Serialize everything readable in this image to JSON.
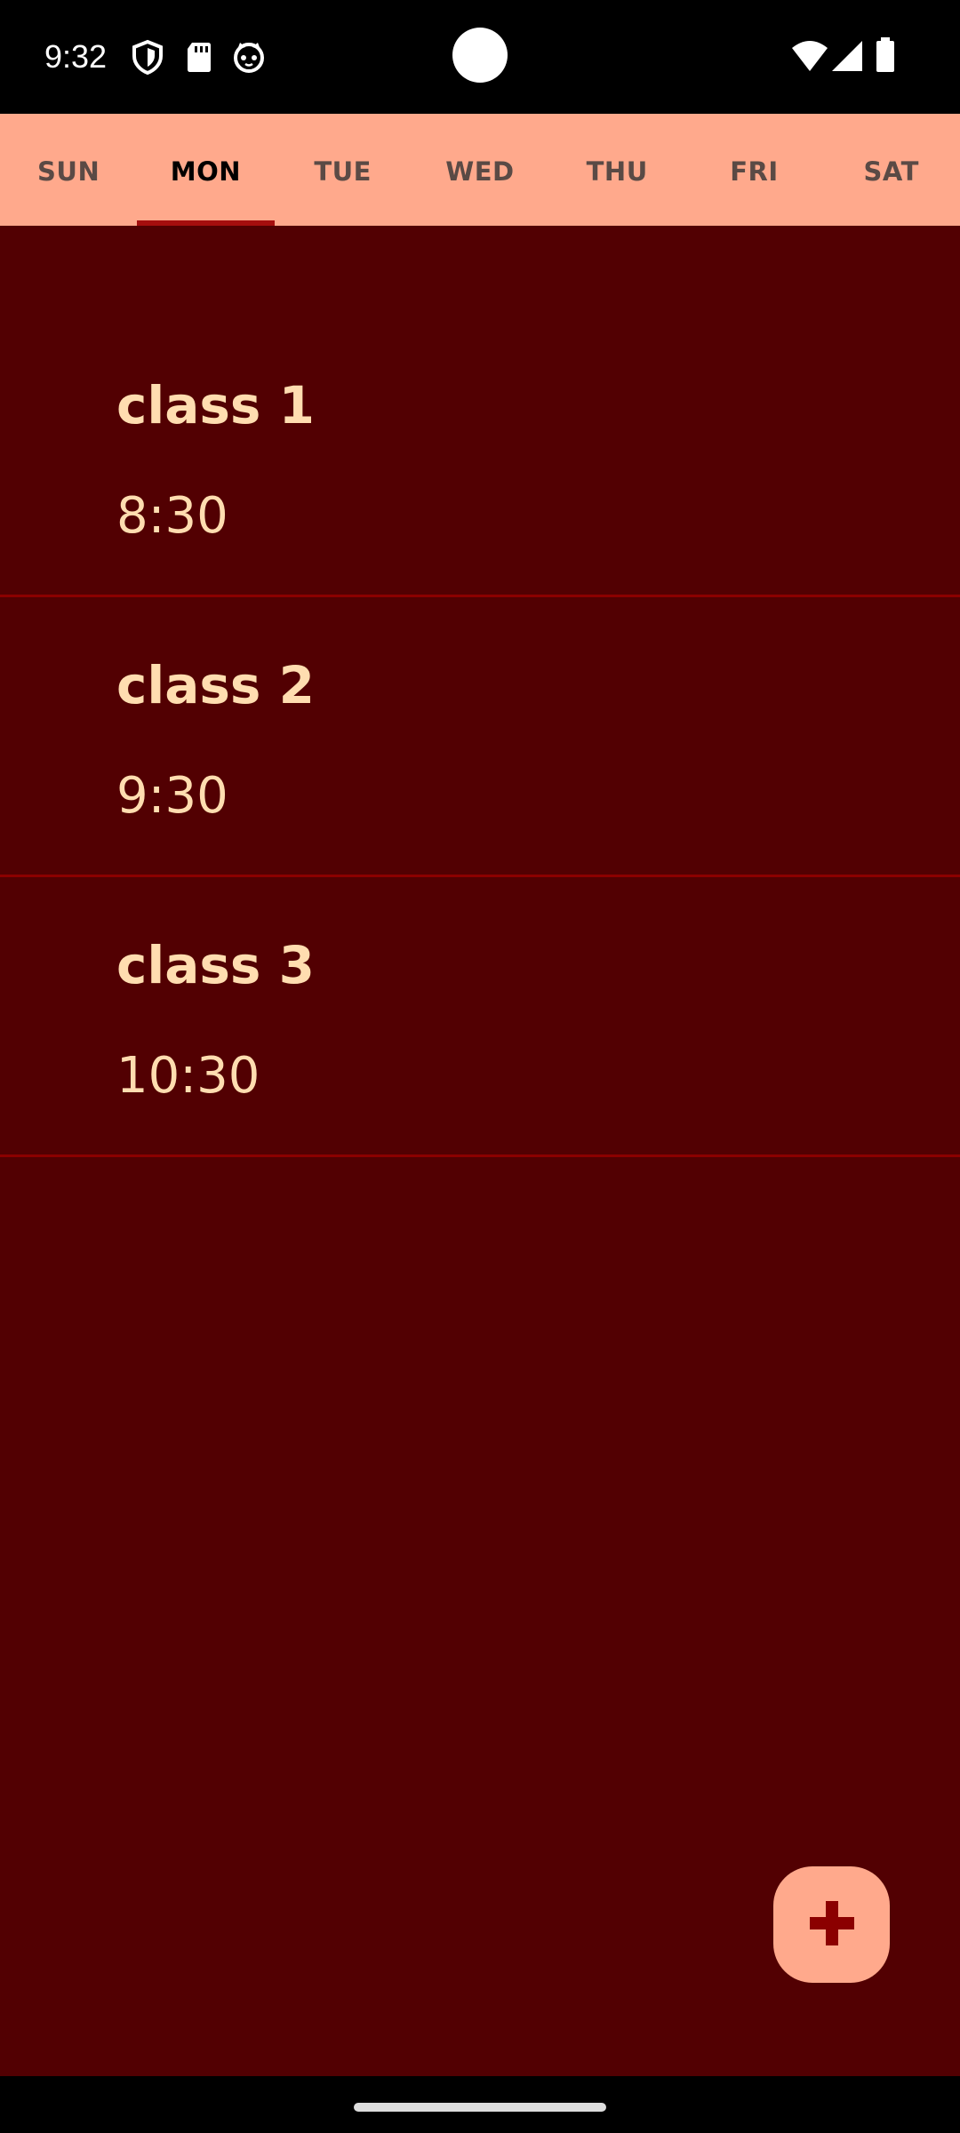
{
  "status_bar": {
    "time": "9:32",
    "icons_left": [
      "shield-icon",
      "sd-card-icon",
      "cat-face-icon"
    ],
    "icons_right": [
      "wifi-icon",
      "cellular-signal-icon",
      "battery-icon"
    ]
  },
  "tabs": [
    {
      "label": "SUN",
      "active": false
    },
    {
      "label": "MON",
      "active": true
    },
    {
      "label": "TUE",
      "active": false
    },
    {
      "label": "WED",
      "active": false
    },
    {
      "label": "THU",
      "active": false
    },
    {
      "label": "FRI",
      "active": false
    },
    {
      "label": "SAT",
      "active": false
    }
  ],
  "classes": [
    {
      "name": "class 1",
      "time": "8:30"
    },
    {
      "name": "class 2",
      "time": "9:30"
    },
    {
      "name": "class 3",
      "time": "10:30"
    }
  ],
  "fab": {
    "icon": "plus-icon"
  },
  "colors": {
    "tab_bar": "#FFA98C",
    "indicator": "#A50E0E",
    "background": "#520002",
    "text": "#FFDDB0",
    "divider": "#8B0000"
  }
}
